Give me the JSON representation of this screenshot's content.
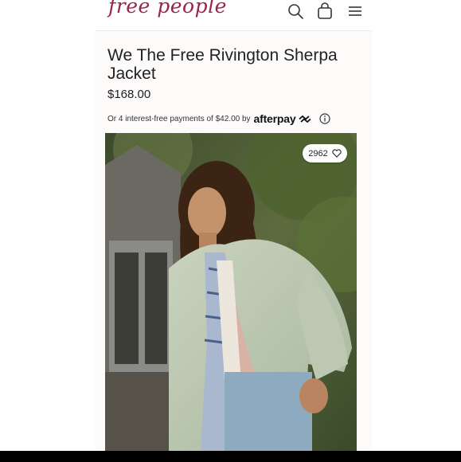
{
  "header": {
    "logo_text": "free people",
    "icons": [
      "search-icon",
      "shopping-bag-icon",
      "menu-icon"
    ]
  },
  "product": {
    "title": "We The Free Rivington Sherpa Jacket",
    "price": "$168.00"
  },
  "afterpay": {
    "text": "Or 4 interest-free payments of $42.00 by",
    "logo_text": "afterpay",
    "icon": "info-icon"
  },
  "image": {
    "favorites_count": "2962",
    "favorite_icon": "heart-icon"
  },
  "colors": {
    "brand": "#9b2449",
    "background": "#fdfafa",
    "text": "#222222"
  }
}
